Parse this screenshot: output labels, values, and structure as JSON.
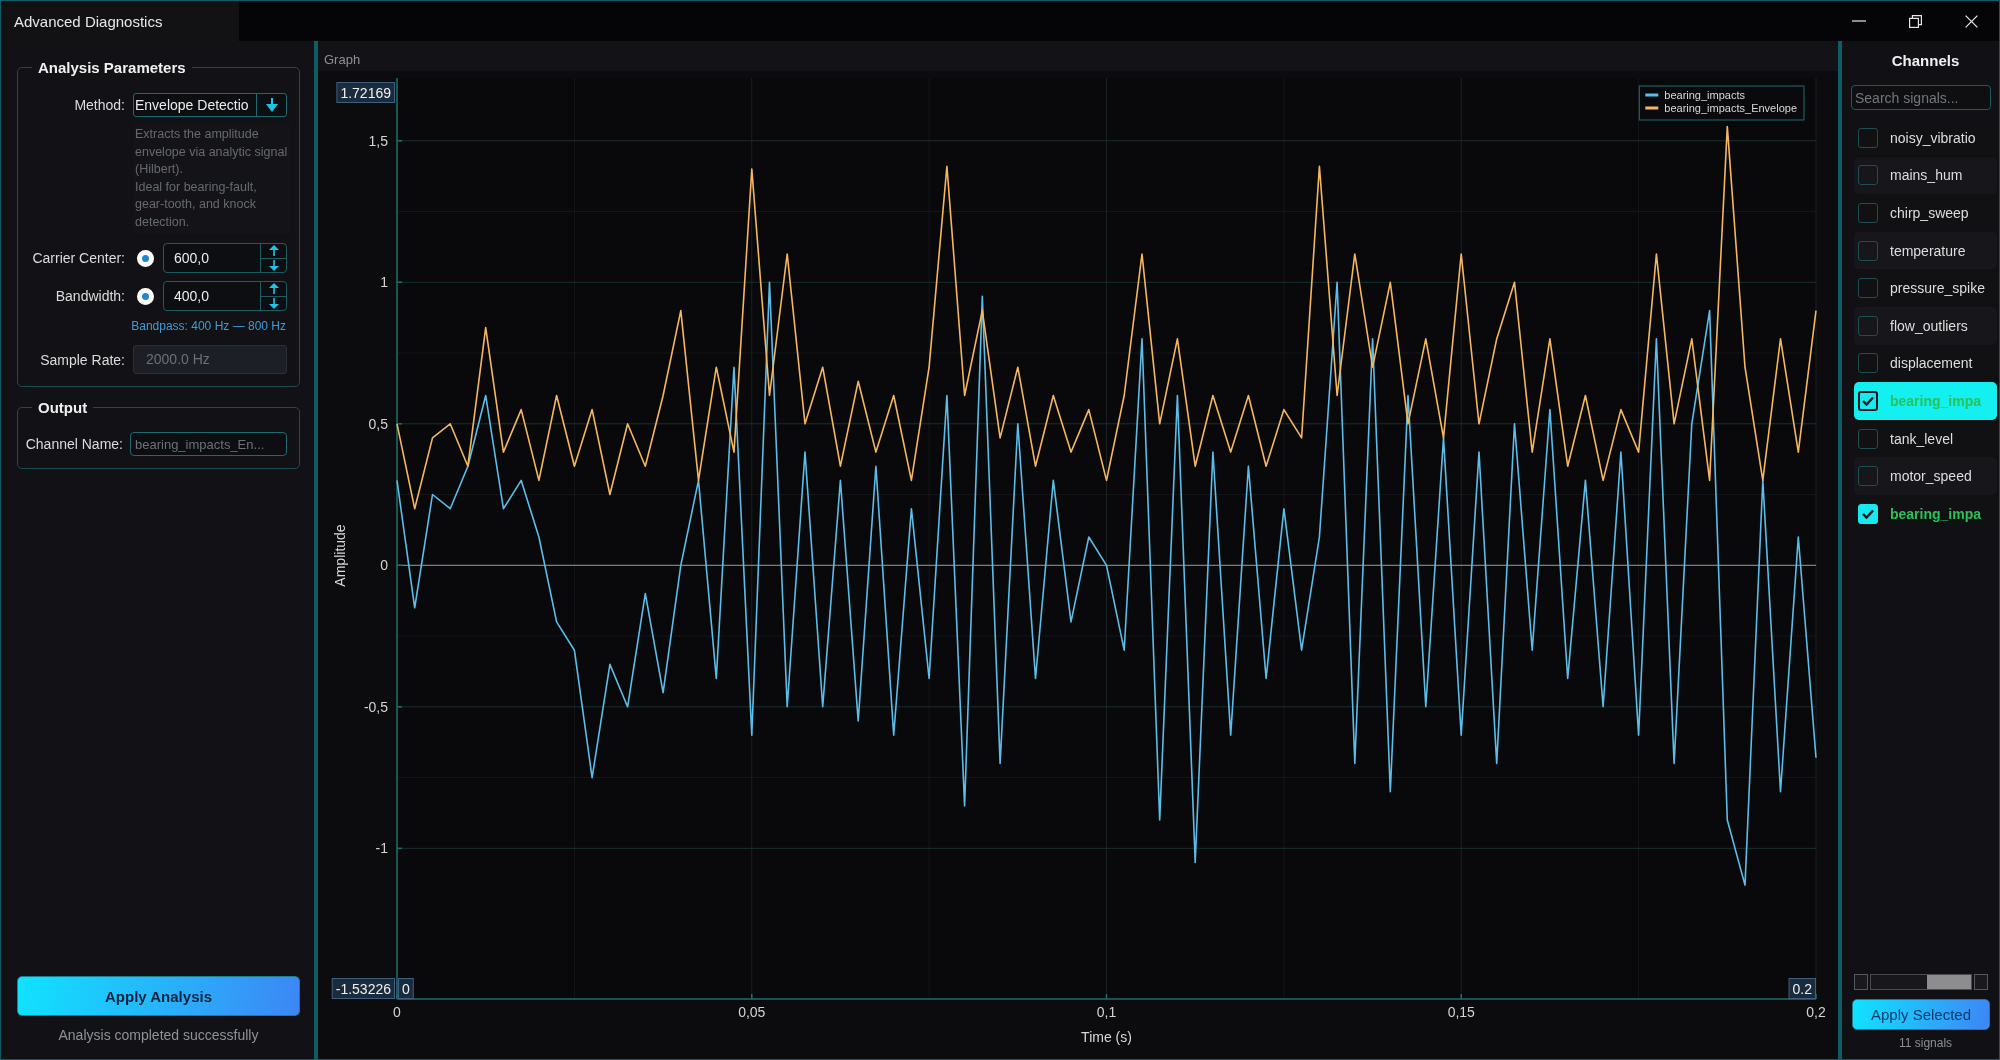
{
  "window": {
    "title": "Advanced Diagnostics"
  },
  "analysis_parameters": {
    "title": "Analysis Parameters",
    "method": {
      "label": "Method:",
      "value": "Envelope Detectio"
    },
    "description": [
      "Extracts the amplitude envelope via analytic signal (Hilbert).",
      "Ideal for bearing-fault, gear-tooth, and knock detection."
    ],
    "carrier_center": {
      "label": "Carrier Center:",
      "on": true,
      "value": "600,0"
    },
    "bandwidth": {
      "label": "Bandwidth:",
      "on": true,
      "value": "400,0"
    },
    "bandpass": "Bandpass: 400 Hz — 800 Hz",
    "sample_rate": {
      "label": "Sample Rate:",
      "value": "2000.0 Hz",
      "disabled": true
    }
  },
  "output": {
    "title": "Output",
    "channel_name": {
      "label": "Channel Name:",
      "placeholder": "bearing_impacts_En..."
    }
  },
  "apply_button": "Apply Analysis",
  "status": "Analysis completed successfully",
  "graph": {
    "title": "Graph",
    "range_labels": {
      "y_max": "1.72169",
      "y_min": "-1.53226",
      "x_min": "0",
      "x_max": "0.2"
    },
    "chart_data": {
      "type": "line",
      "xlabel": "Time (s)",
      "ylabel": "Amplitude",
      "grid": true,
      "legend": "upper right",
      "xlim": [
        0,
        0.2
      ],
      "ylim": [
        -1.53226,
        1.72169
      ],
      "xticks": [
        {
          "value": 0,
          "label": "0"
        },
        {
          "value": 0.05,
          "label": "0,05"
        },
        {
          "value": 0.1,
          "label": "0,1"
        },
        {
          "value": 0.15,
          "label": "0,15"
        },
        {
          "value": 0.2,
          "label": "0,2"
        }
      ],
      "yticks": [
        {
          "value": -1,
          "label": "-1"
        },
        {
          "value": -0.5,
          "label": "-0,5"
        },
        {
          "value": 0,
          "label": "0"
        },
        {
          "value": 0.5,
          "label": "0,5"
        },
        {
          "value": 1,
          "label": "1"
        },
        {
          "value": 1.5,
          "label": "1,5"
        }
      ],
      "x": [
        0,
        0.0025,
        0.005,
        0.0075,
        0.01,
        0.0125,
        0.015,
        0.0175,
        0.02,
        0.0225,
        0.025,
        0.0275,
        0.03,
        0.0325,
        0.035,
        0.0375,
        0.04,
        0.0425,
        0.045,
        0.0475,
        0.05,
        0.0525,
        0.055,
        0.0575,
        0.06,
        0.0625,
        0.065,
        0.0675,
        0.07,
        0.0725,
        0.075,
        0.0775,
        0.08,
        0.0825,
        0.085,
        0.0875,
        0.09,
        0.0925,
        0.095,
        0.0975,
        0.1,
        0.1025,
        0.105,
        0.1075,
        0.11,
        0.1125,
        0.115,
        0.1175,
        0.12,
        0.1225,
        0.125,
        0.1275,
        0.13,
        0.1325,
        0.135,
        0.1375,
        0.14,
        0.1425,
        0.145,
        0.1475,
        0.15,
        0.1525,
        0.155,
        0.1575,
        0.16,
        0.1625,
        0.165,
        0.1675,
        0.17,
        0.1725,
        0.175,
        0.1775,
        0.18,
        0.1825,
        0.185,
        0.1875,
        0.19,
        0.1925,
        0.195,
        0.1975,
        0.2
      ],
      "series": [
        {
          "name": "bearing_impacts",
          "color": "#5bbde8",
          "values": [
            0.3,
            -0.15,
            0.25,
            0.2,
            0.35,
            0.6,
            0.2,
            0.3,
            0.1,
            -0.2,
            -0.3,
            -0.75,
            -0.35,
            -0.5,
            -0.1,
            -0.45,
            0,
            0.3,
            -0.4,
            0.7,
            -0.6,
            1,
            -0.5,
            0.4,
            -0.5,
            0.3,
            -0.55,
            0.35,
            -0.6,
            0.2,
            -0.4,
            0.6,
            -0.85,
            0.95,
            -0.7,
            0.5,
            -0.4,
            0.3,
            -0.2,
            0.1,
            0,
            -0.3,
            0.8,
            -0.9,
            0.6,
            -1.05,
            0.4,
            -0.6,
            0.35,
            -0.4,
            0.2,
            -0.3,
            0.1,
            1,
            -0.7,
            0.8,
            -0.8,
            0.6,
            -0.5,
            0.45,
            -0.6,
            0.4,
            -0.7,
            0.5,
            -0.3,
            0.55,
            -0.4,
            0.3,
            -0.5,
            0.4,
            -0.6,
            0.8,
            -0.7,
            0.5,
            0.9,
            -0.9,
            -1.13,
            0.3,
            -0.8,
            0.1,
            -0.68
          ]
        },
        {
          "name": "bearing_impacts_Envelope",
          "color": "#f5b75e",
          "values": [
            0.5,
            0.2,
            0.45,
            0.5,
            0.35,
            0.84,
            0.4,
            0.55,
            0.3,
            0.6,
            0.35,
            0.55,
            0.25,
            0.5,
            0.35,
            0.6,
            0.9,
            0.3,
            0.7,
            0.4,
            1.4,
            0.6,
            1.1,
            0.5,
            0.7,
            0.35,
            0.65,
            0.4,
            0.6,
            0.3,
            0.7,
            1.41,
            0.6,
            0.9,
            0.45,
            0.7,
            0.35,
            0.6,
            0.4,
            0.55,
            0.3,
            0.6,
            1.1,
            0.5,
            0.8,
            0.35,
            0.6,
            0.4,
            0.6,
            0.35,
            0.55,
            0.45,
            1.41,
            0.6,
            1.1,
            0.7,
            1,
            0.5,
            0.8,
            0.45,
            1.1,
            0.5,
            0.8,
            1,
            0.4,
            0.8,
            0.35,
            0.6,
            0.3,
            0.55,
            0.4,
            1.1,
            0.5,
            0.8,
            0.3,
            1.55,
            0.7,
            0.3,
            0.8,
            0.4,
            0.9
          ]
        }
      ]
    }
  },
  "channels": {
    "title": "Channels",
    "search": {
      "placeholder": "Search signals..."
    },
    "items": [
      {
        "name": "noisy_vibratio",
        "checked": false,
        "selected": false
      },
      {
        "name": "mains_hum",
        "checked": false,
        "selected": false
      },
      {
        "name": "chirp_sweep",
        "checked": false,
        "selected": false
      },
      {
        "name": "temperature",
        "checked": false,
        "selected": false
      },
      {
        "name": "pressure_spike",
        "checked": false,
        "selected": false
      },
      {
        "name": "flow_outliers",
        "checked": false,
        "selected": false
      },
      {
        "name": "displacement",
        "checked": false,
        "selected": false
      },
      {
        "name": "bearing_impa",
        "checked": true,
        "selected": true
      },
      {
        "name": "tank_level",
        "checked": false,
        "selected": false
      },
      {
        "name": "motor_speed",
        "checked": false,
        "selected": false
      },
      {
        "name": "bearing_impa",
        "checked": true,
        "selected": false
      }
    ],
    "apply_button": "Apply Selected",
    "count": "11 signals"
  }
}
